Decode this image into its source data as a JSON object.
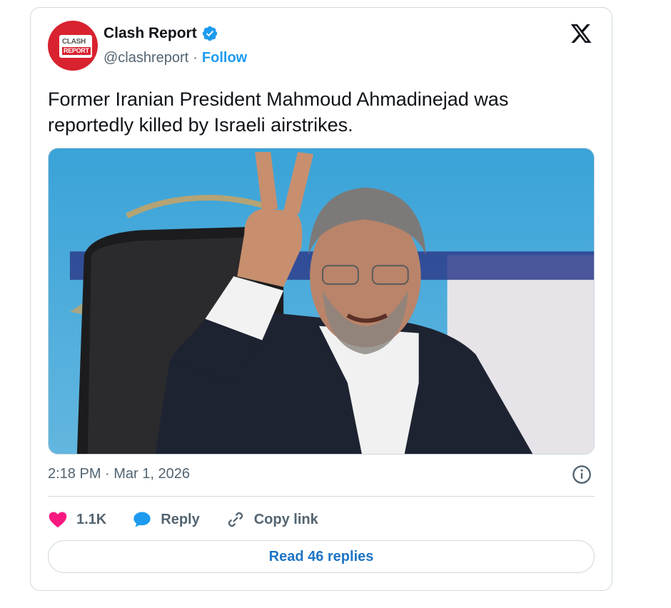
{
  "author": {
    "display_name": "Clash Report",
    "handle": "@clashreport",
    "separator": "·",
    "follow_label": "Follow",
    "avatar_text_line1": "CLASH",
    "avatar_text_line2": "REPORT",
    "verified": true
  },
  "tweet": {
    "text": "Former Iranian President Mahmoud Ahmadinejad was reportedly killed by Israeli airstrikes.",
    "timestamp": "2:18 PM · Mar 1, 2026"
  },
  "actions": {
    "likes_count": "1.1K",
    "reply_label": "Reply",
    "copy_link_label": "Copy link"
  },
  "footer": {
    "read_replies_label": "Read 46 replies"
  },
  "colors": {
    "accent": "#1d9bf0",
    "like": "#f91880",
    "brand": "#d9222f",
    "muted": "#536471"
  },
  "icons": {
    "logo": "x-logo-icon",
    "verified": "verified-badge-icon",
    "info": "info-icon",
    "like": "heart-icon",
    "reply": "speech-bubble-icon",
    "copy": "link-icon"
  }
}
